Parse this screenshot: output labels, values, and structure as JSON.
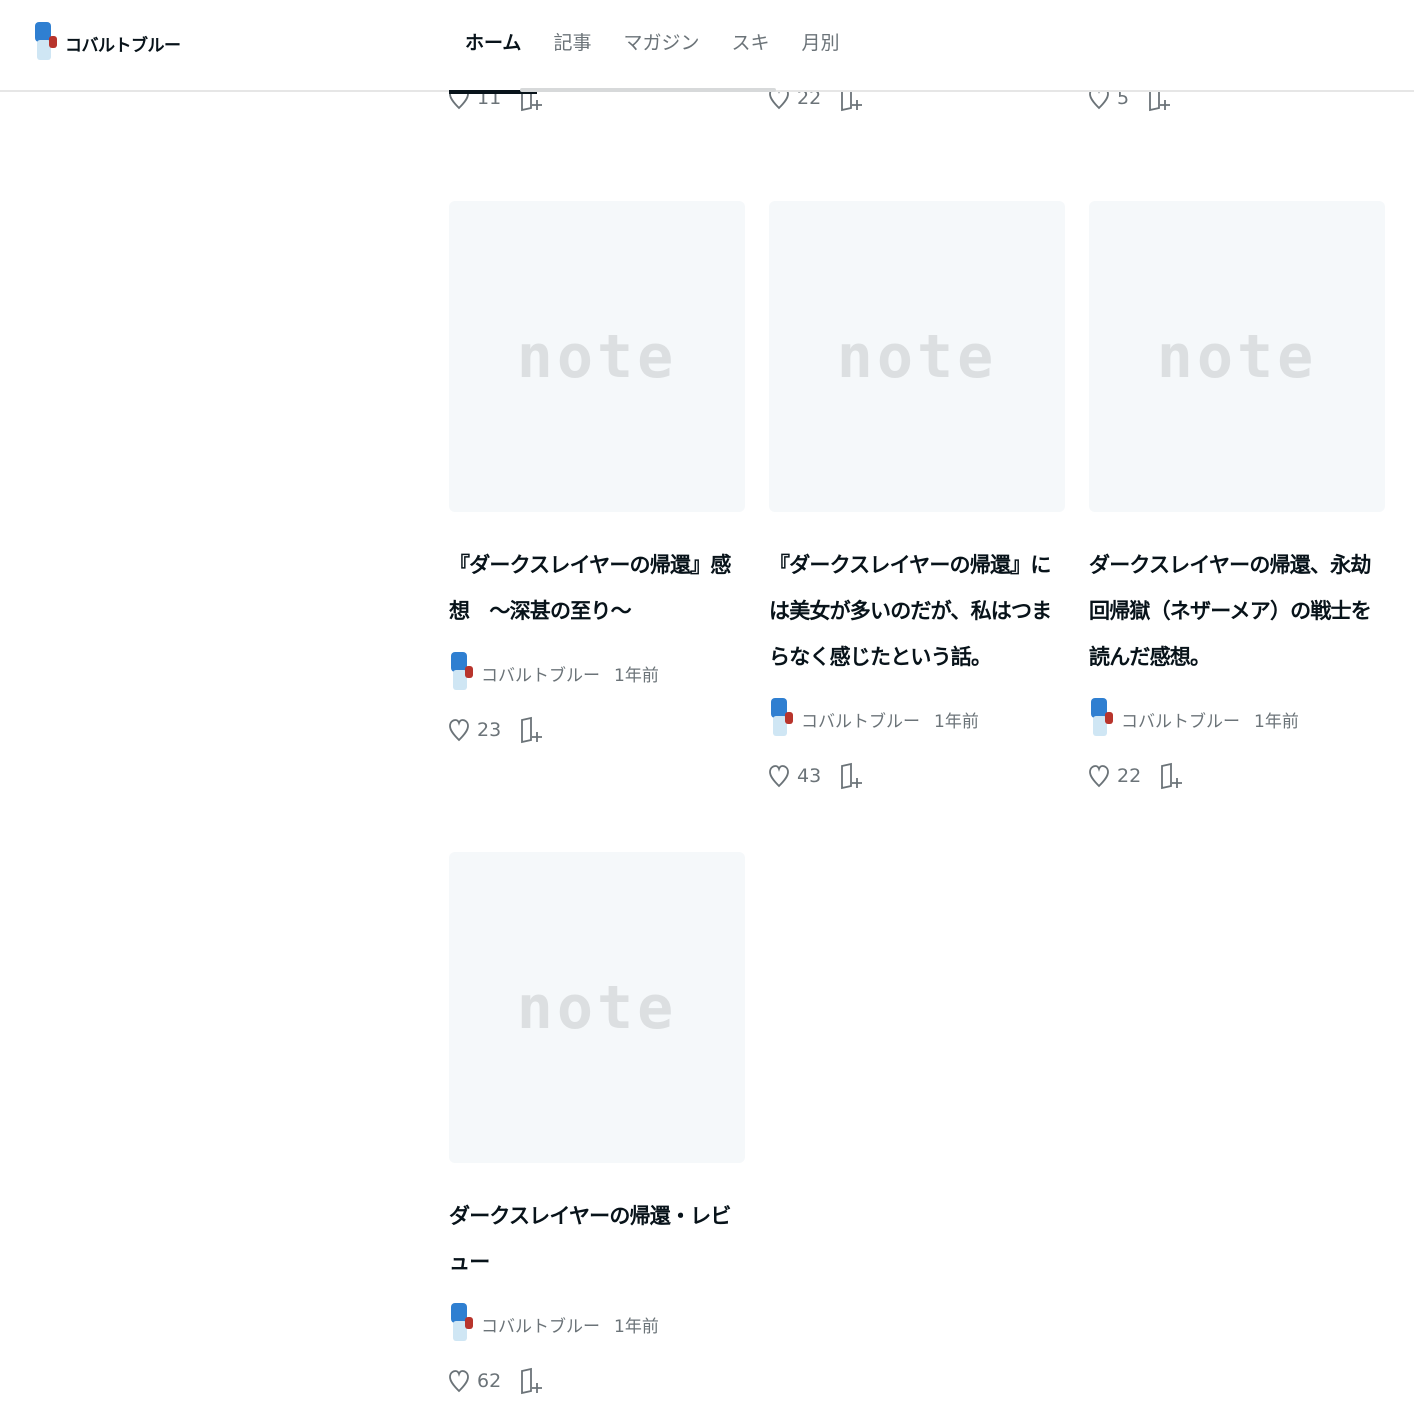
{
  "header": {
    "creator_name": "コバルトブルー",
    "tabs": [
      {
        "label": "ホーム",
        "active": true
      },
      {
        "label": "記事",
        "active": false
      },
      {
        "label": "マガジン",
        "active": false
      },
      {
        "label": "スキ",
        "active": false
      },
      {
        "label": "月別",
        "active": false
      }
    ]
  },
  "partial_row": [
    {
      "likes": "11"
    },
    {
      "likes": "22"
    },
    {
      "likes": "5"
    }
  ],
  "cards": [
    {
      "thumb_logo": "note",
      "title": "『ダークスレイヤーの帰還』感想　〜深甚の至り〜",
      "author": "コバルトブルー",
      "time": "1年前",
      "likes": "23"
    },
    {
      "thumb_logo": "note",
      "title": "『ダークスレイヤーの帰還』には美女が多いのだが、私はつまらなく感じたという話。",
      "author": "コバルトブルー",
      "time": "1年前",
      "likes": "43"
    },
    {
      "thumb_logo": "note",
      "title": "ダークスレイヤーの帰還、永劫回帰獄（ネザーメア）の戦士を読んだ感想。",
      "author": "コバルトブルー",
      "time": "1年前",
      "likes": "22"
    },
    {
      "thumb_logo": "note",
      "title": "ダークスレイヤーの帰還・レビュー",
      "author": "コバルトブルー",
      "time": "1年前",
      "likes": "62"
    }
  ],
  "colors": {
    "accent": "#08131a",
    "muted": "#6b7378",
    "thumb_bg": "#f5f8fa"
  },
  "icons": {
    "like": "heart-icon",
    "save": "magazine-add-icon"
  }
}
